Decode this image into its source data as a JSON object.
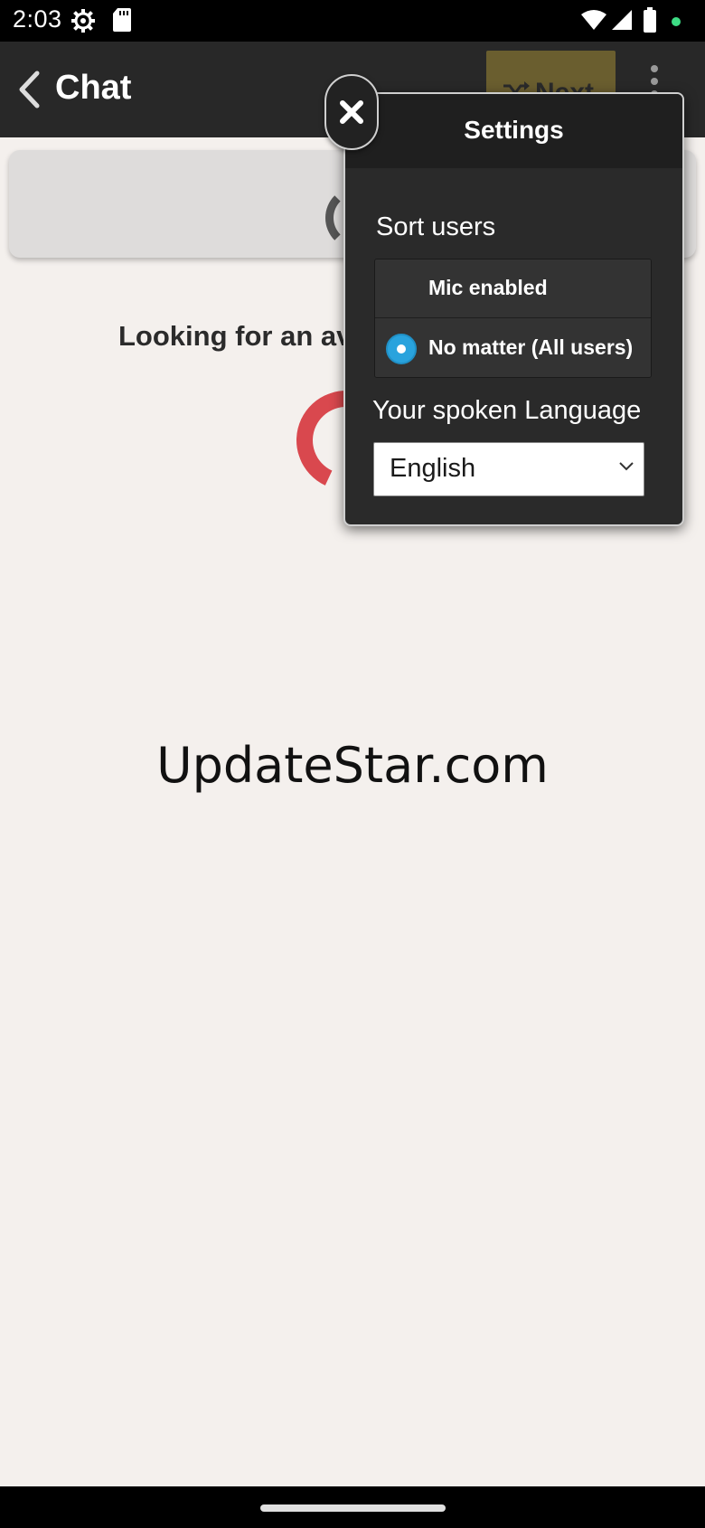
{
  "status_bar": {
    "time": "2:03",
    "icons": [
      "gear-icon",
      "sd-card-icon",
      "wifi-icon",
      "signal-icon",
      "battery-icon",
      "notification-dot-icon"
    ],
    "dot_color": "#3ddc84"
  },
  "app_bar": {
    "title": "Chat",
    "next_label": "Next",
    "next_color": "#6a5e2f"
  },
  "main": {
    "looking_text": "Looking for an av",
    "spinner_color": "#d9484e",
    "watermark": "UpdateStar.com"
  },
  "settings": {
    "title": "Settings",
    "sort_label": "Sort users",
    "options": [
      {
        "label": "Mic enabled",
        "selected": false
      },
      {
        "label": "No matter (All users)",
        "selected": true
      }
    ],
    "language_label": "Your spoken Language",
    "language_value": "English",
    "accent_color": "#29a3dd"
  }
}
